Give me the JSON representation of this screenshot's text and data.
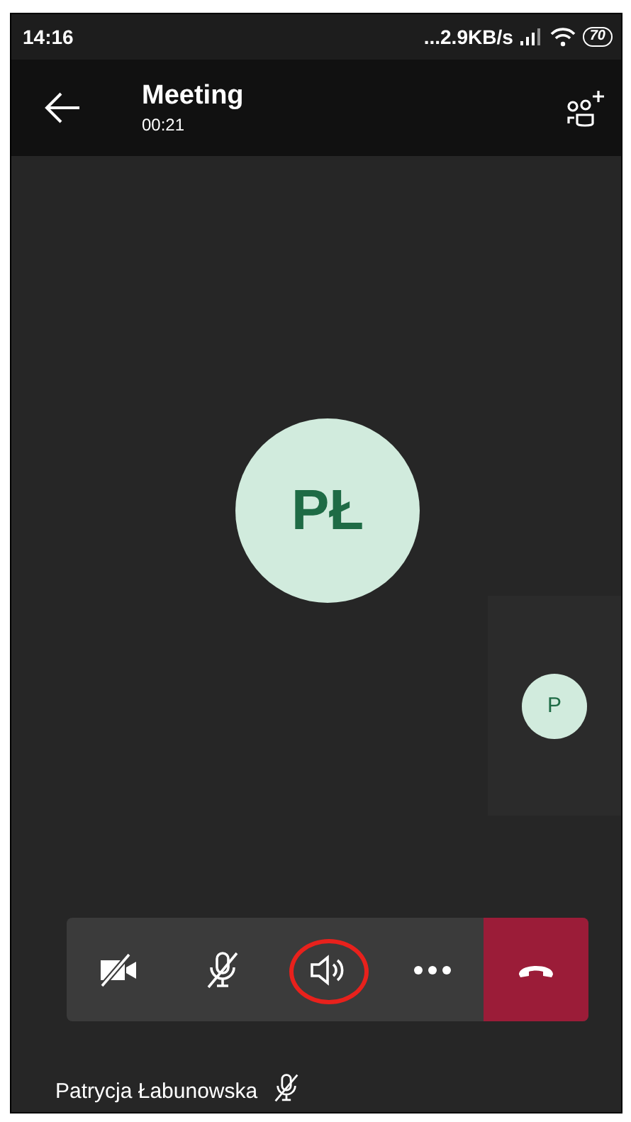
{
  "status_bar": {
    "time": "14:16",
    "network_speed": "...2.9KB/s",
    "battery": "70"
  },
  "header": {
    "title": "Meeting",
    "duration": "00:21"
  },
  "main_participant": {
    "initials": "PŁ"
  },
  "side_tile": {
    "initials": "P"
  },
  "controls": [
    {
      "kind": "camera",
      "on": false,
      "highlighted": false
    },
    {
      "kind": "mic",
      "muted": true,
      "highlighted": false
    },
    {
      "kind": "speaker",
      "highlighted": true
    },
    {
      "kind": "more",
      "highlighted": false
    },
    {
      "kind": "hangup",
      "highlighted": false
    }
  ],
  "footer": {
    "name": "Patrycja Łabunowska",
    "muted": true
  }
}
